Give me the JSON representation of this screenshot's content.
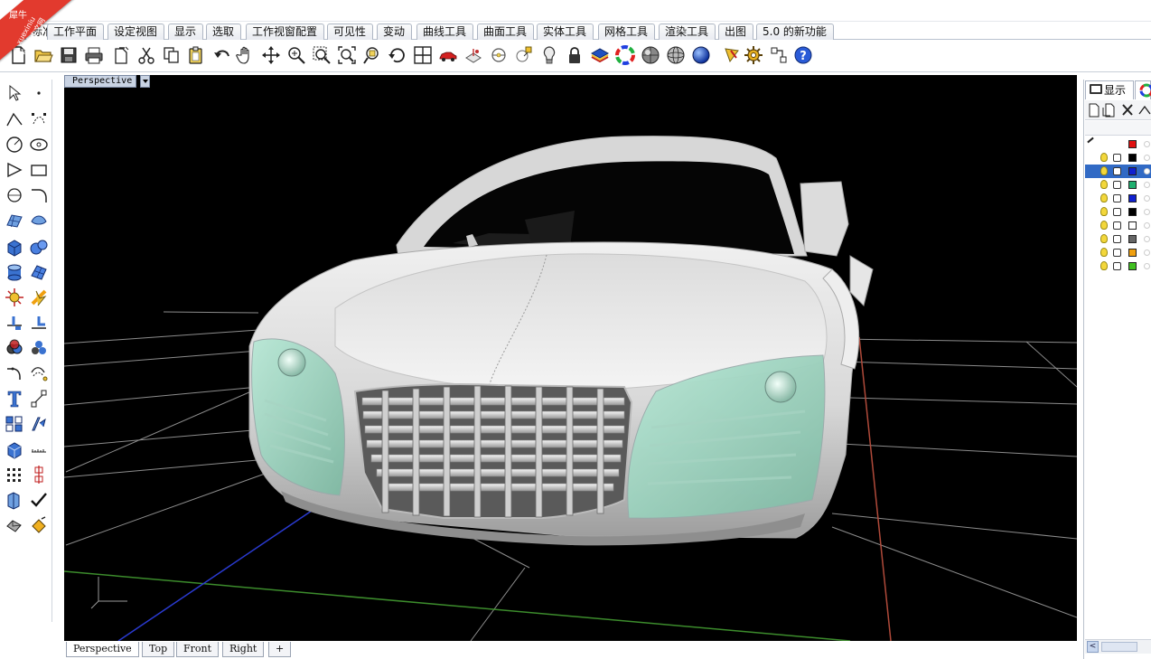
{
  "watermark": {
    "brand_latin": "xuexiniu",
    "brand_cn": "学犀牛中文网",
    "corner_cn": "犀牛"
  },
  "tabs": [
    {
      "label": "标准",
      "active": true
    },
    {
      "label": "工作平面",
      "active": false
    },
    {
      "label": "设定视图",
      "active": false
    },
    {
      "label": "显示",
      "active": false
    },
    {
      "label": "选取",
      "active": false
    },
    {
      "label": "工作视窗配置",
      "active": false
    },
    {
      "label": "可见性",
      "active": false
    },
    {
      "label": "变动",
      "active": false
    },
    {
      "label": "曲线工具",
      "active": false
    },
    {
      "label": "曲面工具",
      "active": false
    },
    {
      "label": "实体工具",
      "active": false
    },
    {
      "label": "网格工具",
      "active": false
    },
    {
      "label": "渲染工具",
      "active": false
    },
    {
      "label": "出图",
      "active": false
    },
    {
      "label": "5.0 的新功能",
      "active": false
    }
  ],
  "main_toolbar_icons": [
    "new-document-icon",
    "open-folder-icon",
    "save-icon",
    "print-icon",
    "import-icon",
    "cut-icon",
    "copy-icon",
    "paste-icon",
    "undo-icon",
    "pan-hand-icon",
    "move-view-icon",
    "zoom-icon",
    "zoom-window-icon",
    "zoom-extents-icon",
    "zoom-selected-icon",
    "rotate-view-icon",
    "viewport-layout-icon",
    "car-icon",
    "named-cplane-icon",
    "grid-snap-icon",
    "osnap-icon",
    "light-bulb-icon",
    "lock-icon",
    "layer-icon",
    "color-wheel-icon",
    "render-sphere-icon",
    "shaded-sphere-icon",
    "render-blue-sphere-icon",
    "pencil-flag-icon",
    "gear-options-icon",
    "dimension-icon",
    "help-icon"
  ],
  "left_toolbar_icons": [
    "select-arrow-icon",
    "point-icon",
    "polyline-icon",
    "curve-edit-icon",
    "circle-icon",
    "ellipse-icon",
    "polygon-icon",
    "rectangle-icon",
    "arc-icon",
    "fillet-curve-icon",
    "surface-grid-icon",
    "surface-edit-icon",
    "box-solid-icon",
    "sphere-solid-icon",
    "cylinder-icon",
    "mesh-icon",
    "explode-icon",
    "trim-icon",
    "split-icon",
    "join-icon",
    "boolean-icon",
    "group-icon",
    "fillet-icon",
    "offset-icon",
    "text-icon",
    "dimension-icon",
    "array-icon",
    "transform-icon",
    "solid-edit-icon",
    "block-icon",
    "grid-array-icon",
    "align-icon",
    "analyze-icon",
    "check-icon",
    "render-icon",
    "paint-bucket-icon"
  ],
  "viewport": {
    "title": "Perspective",
    "background": "#000000"
  },
  "viewport_tabs": [
    {
      "label": "Perspective",
      "active": true
    },
    {
      "label": "Top",
      "active": false
    },
    {
      "label": "Front",
      "active": false
    },
    {
      "label": "Right",
      "active": false
    },
    {
      "label": "+",
      "active": false
    }
  ],
  "right_panel": {
    "tab_label": "显示",
    "layers": [
      {
        "color": "#e01010",
        "selected": false,
        "show_controls": false
      },
      {
        "color": "#000000",
        "selected": false,
        "show_controls": true
      },
      {
        "color": "#1020d0",
        "selected": true,
        "show_controls": true
      },
      {
        "color": "#20b070",
        "selected": false,
        "show_controls": true
      },
      {
        "color": "#1020d0",
        "selected": false,
        "show_controls": true
      },
      {
        "color": "#000000",
        "selected": false,
        "show_controls": true
      },
      {
        "color": "#ffffff",
        "selected": false,
        "show_controls": true
      },
      {
        "color": "#666666",
        "selected": false,
        "show_controls": true
      },
      {
        "color": "#f0a010",
        "selected": false,
        "show_controls": true
      },
      {
        "color": "#40c020",
        "selected": false,
        "show_controls": true
      }
    ]
  }
}
